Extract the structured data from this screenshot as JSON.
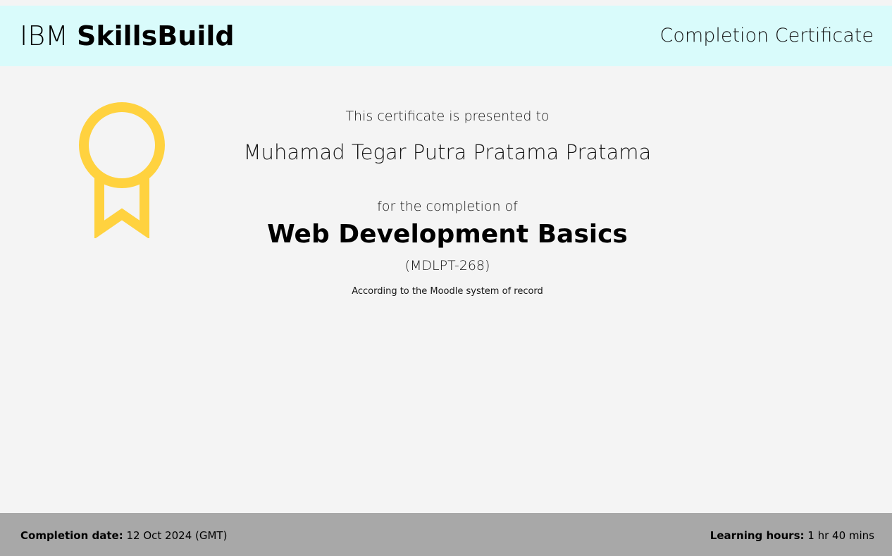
{
  "header": {
    "brand_prefix": "IBM",
    "brand_name": "SkillsBuild",
    "document_type": "Completion Certificate"
  },
  "certificate": {
    "presented_text": "This certificate is presented to",
    "recipient_name": "Muhamad Tegar Putra Pratama Pratama",
    "completion_text": "for the completion of",
    "course_title": "Web Development Basics",
    "course_code": "(MDLPT-268)",
    "record_note": "According to the Moodle system of record",
    "badge_icon": "award-ribbon-icon",
    "badge_color": "#ffd23f"
  },
  "footer": {
    "completion_label": "Completion date:",
    "completion_value": "12 Oct 2024 (GMT)",
    "hours_label": "Learning hours:",
    "hours_value": "1 hr 40 mins"
  },
  "colors": {
    "header_background": "#d9fbfb",
    "body_background": "#f4f4f4",
    "footer_background": "#a8a8a8"
  }
}
